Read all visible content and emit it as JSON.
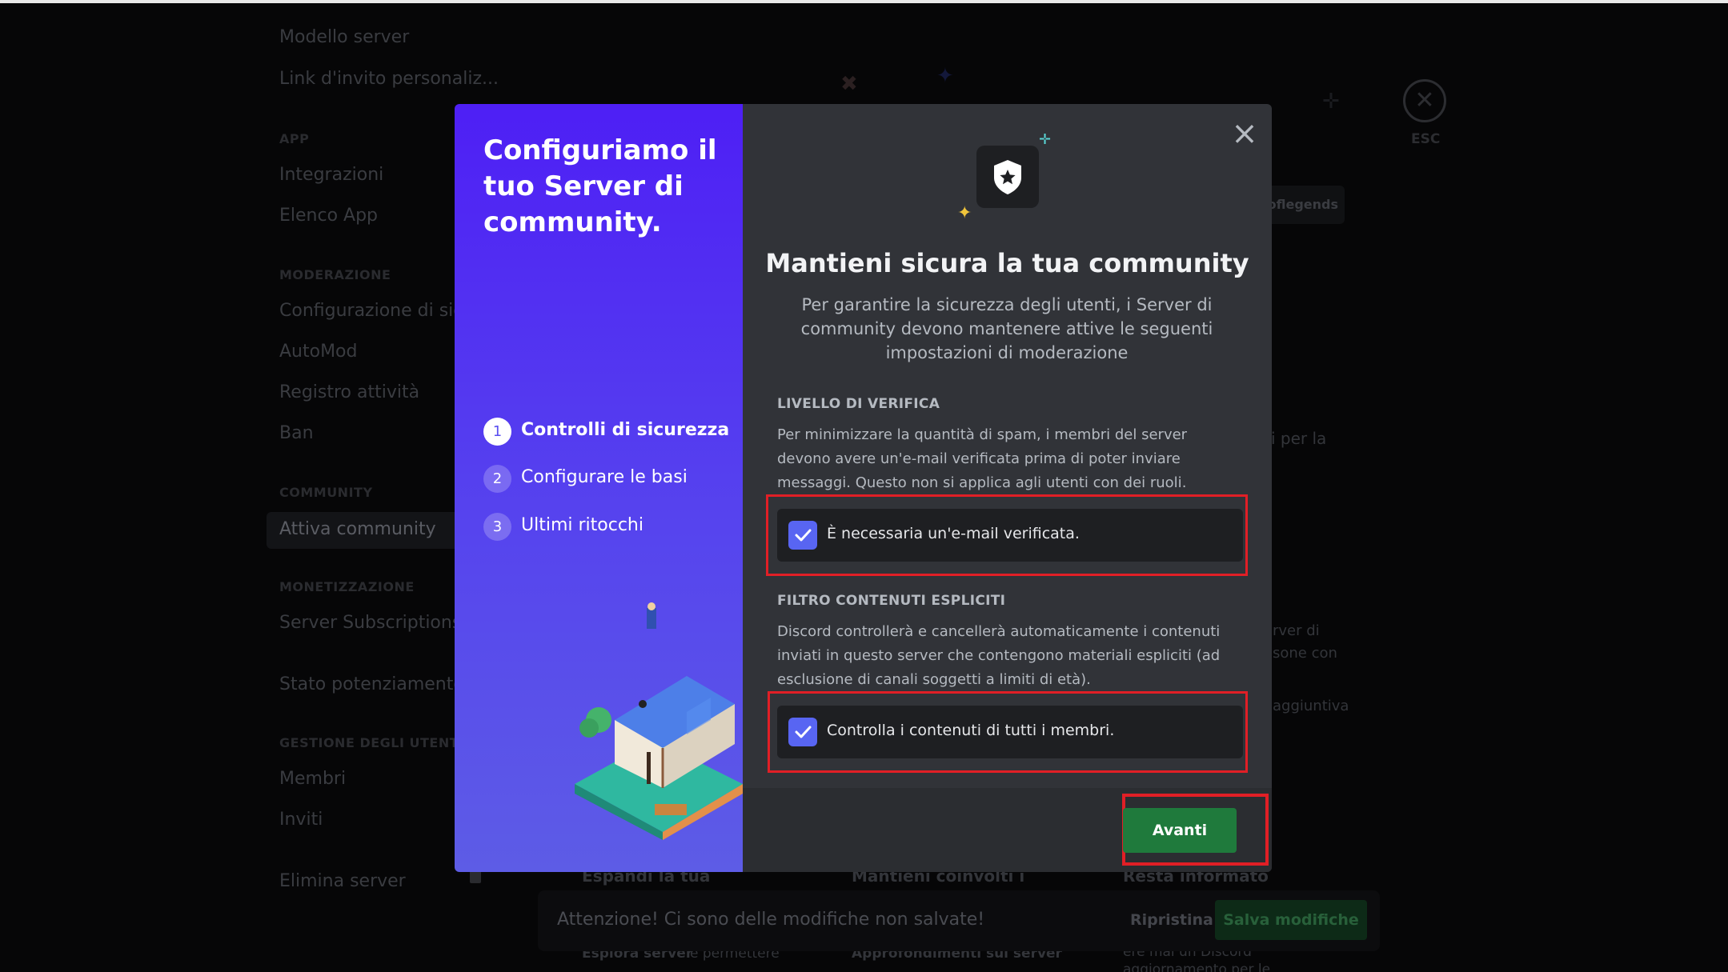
{
  "sidebar": {
    "items_top": [
      "Modello server",
      "Link d'invito personaliz..."
    ],
    "app_header": "APP",
    "app_items": [
      "Integrazioni",
      "Elenco App"
    ],
    "moderation_header": "MODERAZIONE",
    "moderation_items": [
      "Configurazione di sicurezza",
      "AutoMod",
      "Registro attività",
      "Ban"
    ],
    "community_header": "COMMUNITY",
    "community_active": "Attiva community",
    "monetization_header": "MONETIZZAZIONE",
    "monetization_items": [
      "Server Subscriptions",
      "Stato potenziamento"
    ],
    "users_header": "GESTIONE DEGLI UTENTI",
    "users_items": [
      "Membri",
      "Inviti"
    ],
    "delete_server": "Elimina server"
  },
  "background": {
    "esc_label": "ESC",
    "esc_icon": "close-icon",
    "fragments": [
      "oflegends",
      "i per la",
      "rver di",
      "sone con",
      "aggiuntiva",
      "Espandi la tua",
      "Mantieni coinvolti i",
      "Resta informato",
      "Esplora server",
      "e permettere",
      "Approfondimenti sul server",
      "ere mai un Discord",
      "aggiornamento per le"
    ]
  },
  "savebar": {
    "message": "Attenzione! Ci sono delle modifiche non salvate!",
    "reset": "Ripristina",
    "save": "Salva modifiche"
  },
  "modal": {
    "heading": "Configuriamo il tuo Server di community.",
    "steps": [
      {
        "num": "1",
        "label": "Controlli di sicurezza",
        "active": true
      },
      {
        "num": "2",
        "label": "Configurare le basi",
        "active": false
      },
      {
        "num": "3",
        "label": "Ultimi ritocchi",
        "active": false
      }
    ],
    "close_icon": "close-icon",
    "hero_icon": "shield-star-icon",
    "title": "Mantieni sicura la tua community",
    "subtitle": "Per garantire la sicurezza degli utenti, i Server di community devono mantenere attive le seguenti impostazioni di moderazione",
    "verification": {
      "header": "LIVELLO DI VERIFICA",
      "description": "Per minimizzare la quantità di spam, i membri del server devono avere un'e-mail verificata prima di poter inviare messaggi. Questo non si applica agli utenti con dei ruoli.",
      "checkbox_label": "È necessaria un'e-mail verificata.",
      "checked": true
    },
    "content_filter": {
      "header": "FILTRO CONTENUTI ESPLICITI",
      "description": "Discord controllerà e cancellerà automaticamente i contenuti inviati in questo server che contengono materiali espliciti (ad esclusione di canali soggetti a limiti di età).",
      "checkbox_label": "Controlla i contenuti di tutti i membri.",
      "checked": true
    },
    "next_button": "Avanti"
  },
  "colors": {
    "accent": "#5865f2",
    "highlight": "#e11f26",
    "next_button": "#1f7a3c",
    "modal_gradient_top": "#4e1ff5",
    "modal_gradient_bottom": "#5d5ce6"
  }
}
